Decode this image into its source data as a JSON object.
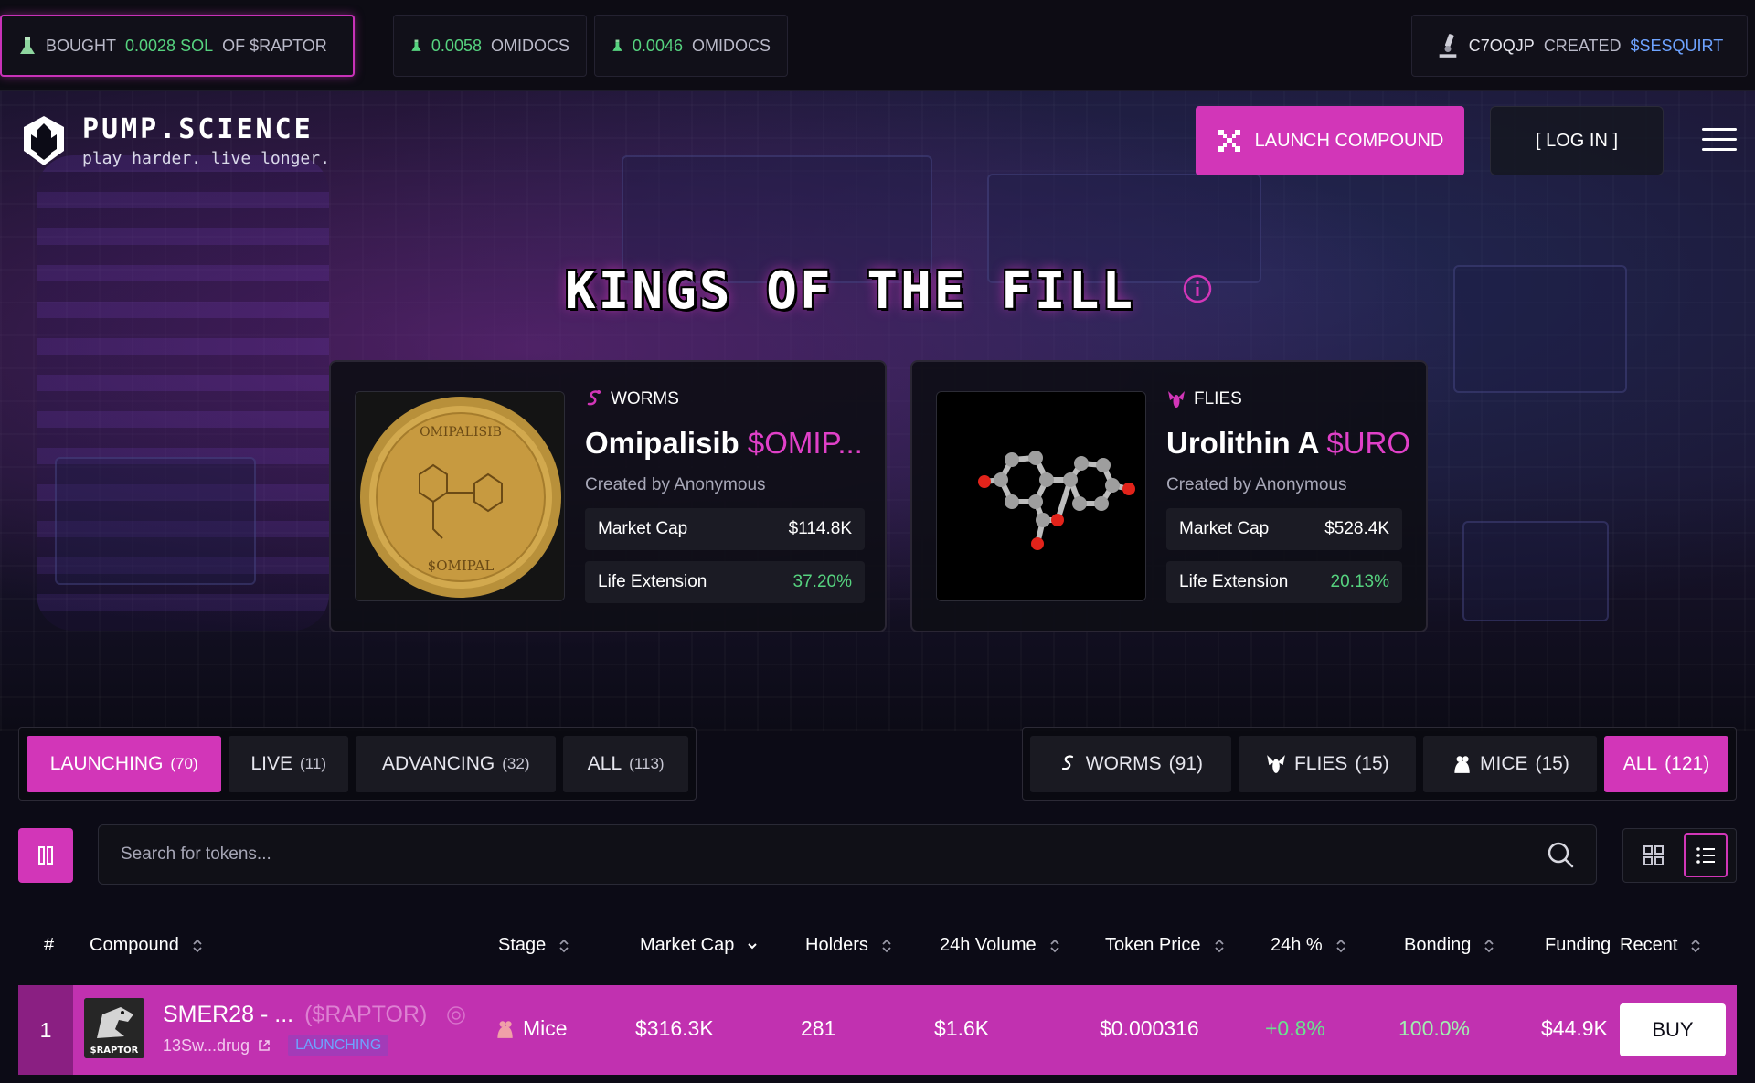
{
  "ticker": {
    "bought": {
      "action": "BOUGHT",
      "amount": "0.0028 SOL",
      "suffix": "OF $RAPTOR"
    },
    "items": [
      {
        "amount": "0.0058",
        "token": "OMIDOCS"
      },
      {
        "amount": "0.0046",
        "token": "OMIDOCS"
      }
    ],
    "created": {
      "user": "C7OQJP",
      "action": "CREATED",
      "token": "$SESQUIRT"
    }
  },
  "header": {
    "logo_title": "PUMP.SCIENCE",
    "logo_tagline": "play harder. live longer.",
    "launch_label": "LAUNCH COMPOUND",
    "login_label": "[ LOG IN ]"
  },
  "kings": {
    "title": "KINGS OF THE FILL",
    "cards": [
      {
        "category": "WORMS",
        "name": "Omipalisib",
        "ticker": "$OMIP...",
        "creator_prefix": "Created by",
        "creator": "Anonymous",
        "market_cap_label": "Market Cap",
        "market_cap": "$114.8K",
        "life_ext_label": "Life Extension",
        "life_ext": "37.20%",
        "coin_top_text": "OMIPALISIB",
        "coin_bottom_text": "$OMIPAL"
      },
      {
        "category": "FLIES",
        "name": "Urolithin A",
        "ticker": "$URO",
        "creator_prefix": "Created by",
        "creator": "Anonymous",
        "market_cap_label": "Market Cap",
        "market_cap": "$528.4K",
        "life_ext_label": "Life Extension",
        "life_ext": "20.13%"
      }
    ]
  },
  "stage_tabs": [
    {
      "label": "LAUNCHING",
      "count": "(70)",
      "active": true
    },
    {
      "label": "LIVE",
      "count": "(11)",
      "active": false
    },
    {
      "label": "ADVANCING",
      "count": "(32)",
      "active": false
    },
    {
      "label": "ALL",
      "count": "(113)",
      "active": false
    }
  ],
  "species_tabs": [
    {
      "label": "WORMS",
      "count": "(91)",
      "icon": "worm-icon",
      "active": false
    },
    {
      "label": "FLIES",
      "count": "(15)",
      "icon": "fly-icon",
      "active": false
    },
    {
      "label": "MICE",
      "count": "(15)",
      "icon": "mouse-icon",
      "active": false
    },
    {
      "label": "ALL",
      "count": "(121)",
      "active": true
    }
  ],
  "search": {
    "placeholder": "Search for tokens..."
  },
  "table": {
    "headers": {
      "rank": "#",
      "compound": "Compound",
      "stage": "Stage",
      "market_cap": "Market Cap",
      "holders": "Holders",
      "volume": "24h Volume",
      "price": "Token Price",
      "change": "24h %",
      "bonding": "Bonding",
      "funding": "Funding",
      "recent": "Recent"
    },
    "rows": [
      {
        "rank": "1",
        "name": "SMER28 - ...",
        "ticker": "($RAPTOR)",
        "address": "13Sw...drug",
        "badge": "LAUNCHING",
        "stage": "Mice",
        "market_cap": "$316.3K",
        "holders": "281",
        "volume": "$1.6K",
        "price": "$0.000316",
        "change": "+0.8%",
        "bonding": "100.0%",
        "funding": "$44.9K",
        "buy_label": "BUY",
        "thumb_text": "$RAPTOR"
      }
    ]
  },
  "colors": {
    "accent": "#d236b8",
    "green": "#56d37f",
    "blue": "#6ea3ff",
    "background": "#0c0b16"
  }
}
